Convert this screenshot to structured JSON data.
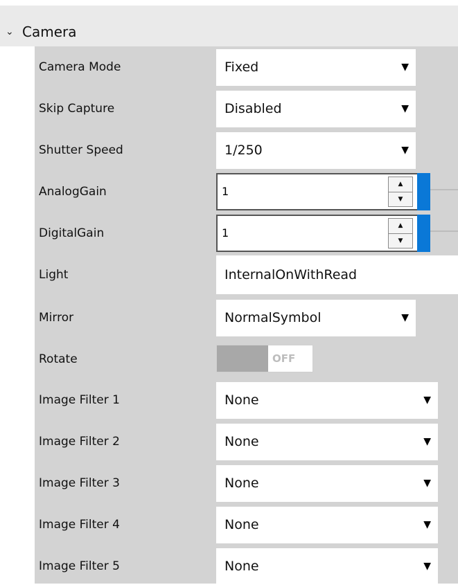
{
  "section": {
    "title": "Camera",
    "icon": "chevron-down-icon"
  },
  "fields": {
    "camera_mode": {
      "label": "Camera Mode",
      "value": "Fixed"
    },
    "skip_capture": {
      "label": "Skip Capture",
      "value": "Disabled"
    },
    "shutter_speed": {
      "label": "Shutter Speed",
      "value": "1/250"
    },
    "analog_gain": {
      "label": "AnalogGain",
      "value": "1"
    },
    "digital_gain": {
      "label": "DigitalGain",
      "value": "1"
    },
    "light": {
      "label": "Light",
      "value": "InternalOnWithRead"
    },
    "mirror": {
      "label": "Mirror",
      "value": "NormalSymbol"
    },
    "rotate": {
      "label": "Rotate",
      "state": "OFF"
    },
    "image_filters": [
      {
        "label": "Image Filter 1",
        "value": "None"
      },
      {
        "label": "Image Filter 2",
        "value": "None"
      },
      {
        "label": "Image Filter 3",
        "value": "None"
      },
      {
        "label": "Image Filter 4",
        "value": "None"
      },
      {
        "label": "Image Filter 5",
        "value": "None"
      }
    ]
  },
  "glyphs": {
    "dropdown_arrow": "▼",
    "spin_up": "▲",
    "spin_down": "▼",
    "chevron": "⌄"
  },
  "colors": {
    "accent": "#0a78d7",
    "panel": "#d3d3d3",
    "header": "#eaeaea",
    "toggle_off": "#a8a8a8"
  }
}
